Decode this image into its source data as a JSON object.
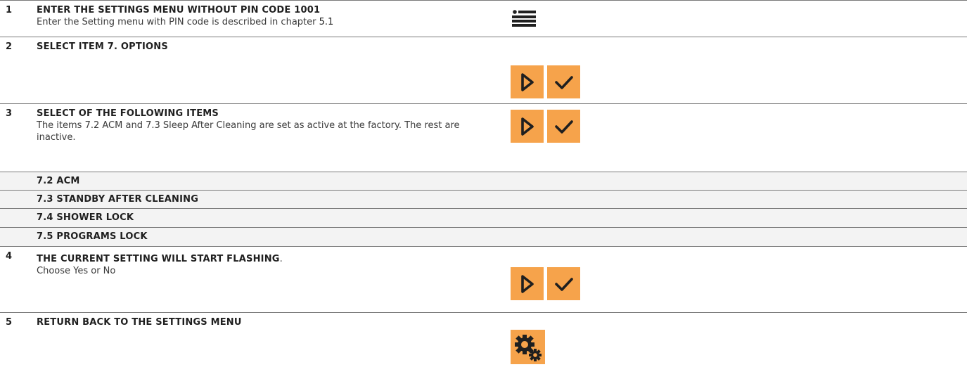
{
  "steps": [
    {
      "num": "1",
      "title": "ENTER THE SETTINGS MENU WITHOUT PIN CODE 1001",
      "desc": "Enter the Setting menu with PIN code is described in chapter ",
      "desc_ref": "5.1",
      "icons": [
        "menu-list-icon"
      ]
    },
    {
      "num": "2",
      "title": "SELECT ITEM 7. OPTIONS",
      "icons": [
        "play-arrow-icon",
        "checkmark-icon"
      ]
    },
    {
      "num": "3",
      "title": "SELECT OF THE FOLLOWING ITEMS",
      "desc": "The items 7.2 ACM and 7.3 Sleep After Cleaning are set as active at the factory. The rest are inactive.",
      "icons": [
        "play-arrow-icon",
        "checkmark-icon"
      ]
    },
    {
      "num": "4",
      "title": "THE CURRENT SETTING WILL START FLASHING",
      "title_suffix": ".",
      "desc": "Choose Yes or No",
      "icons": [
        "play-arrow-icon",
        "checkmark-icon"
      ]
    },
    {
      "num": "5",
      "title": "RETURN BACK TO THE SETTINGS MENU",
      "icons": [
        "settings-gears-icon"
      ]
    }
  ],
  "sub_items": [
    "7.2 ACM",
    "7.3 STANDBY AFTER CLEANING",
    "7.4 SHOWER LOCK",
    "7.5 PROGRAMS LOCK"
  ],
  "colors": {
    "button_orange": "#f6a34b",
    "icon_dark": "#1f1f1f",
    "sub_row_bg": "#f3f3f3",
    "rule": "#7a7a7a"
  }
}
